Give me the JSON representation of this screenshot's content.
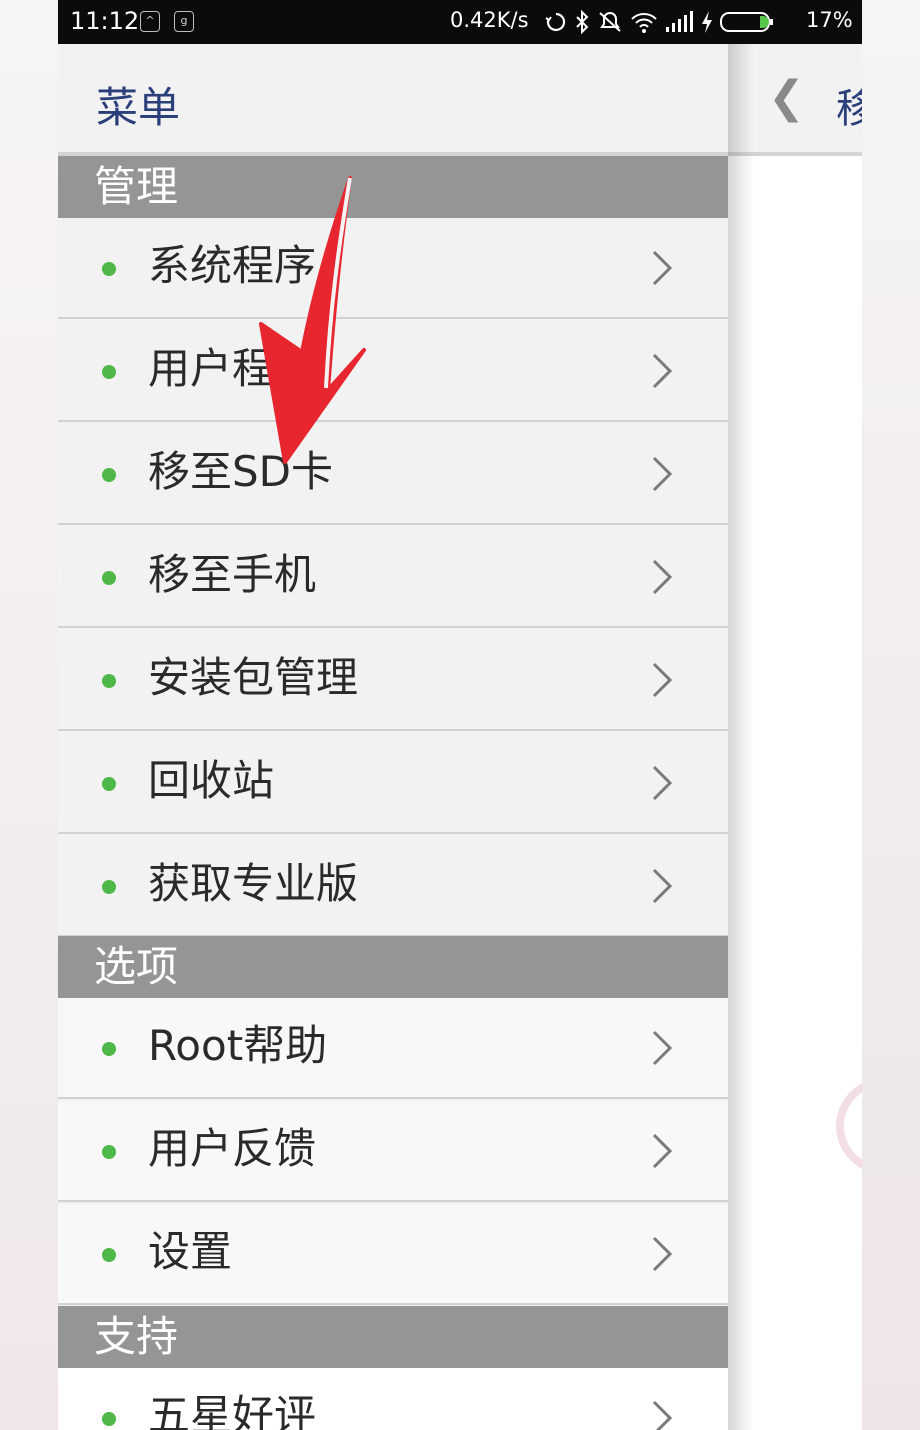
{
  "status_bar": {
    "time": "11:12",
    "speed": "0.42K/s",
    "battery": "17%",
    "icons": [
      "notification-box-icon",
      "notification-box-icon",
      "sync-icon",
      "bluetooth-icon",
      "mute-icon",
      "wifi-icon",
      "signal-icon",
      "charging-icon",
      "battery-icon"
    ]
  },
  "drawer": {
    "title": "菜单",
    "sections": [
      {
        "title": "管理",
        "items": [
          {
            "label": "系统程序"
          },
          {
            "label": "用户程序"
          },
          {
            "label": "移至SD卡"
          },
          {
            "label": "移至手机"
          },
          {
            "label": "安装包管理"
          },
          {
            "label": "回收站"
          },
          {
            "label": "获取专业版"
          }
        ]
      },
      {
        "title": "选项",
        "items": [
          {
            "label": "Root帮助"
          },
          {
            "label": "用户反馈"
          },
          {
            "label": "设置"
          }
        ]
      },
      {
        "title": "支持",
        "items": [
          {
            "label": "五星好评"
          }
        ]
      }
    ]
  },
  "background_page": {
    "title": "移"
  },
  "colors": {
    "accent_title": "#2b3f7a",
    "section_bg": "#959595",
    "bullet": "#4fb848",
    "annotation_arrow": "#e8262f"
  }
}
